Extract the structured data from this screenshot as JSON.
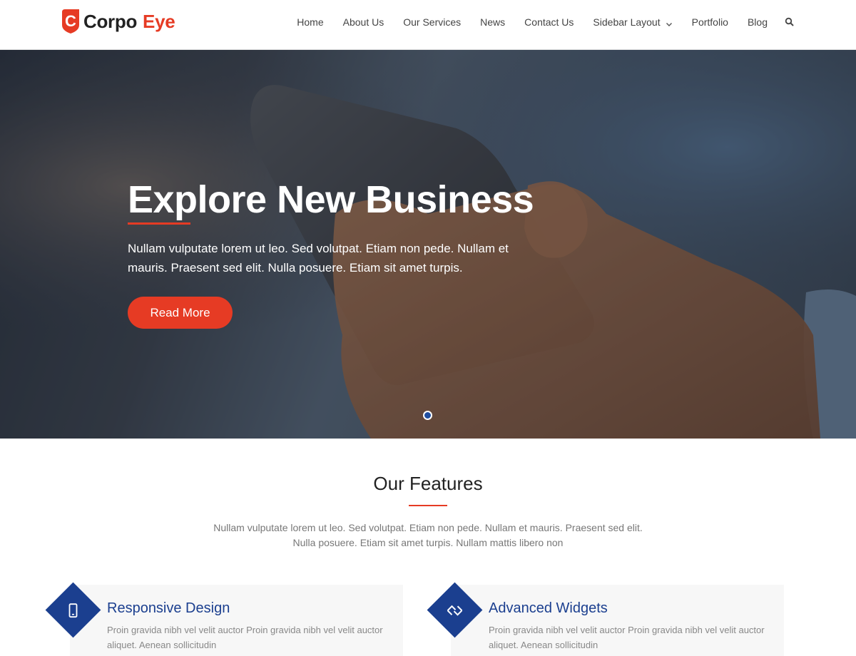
{
  "brand": {
    "name_part1": "Corpo",
    "name_part2": "Eye",
    "logo_letter": "C",
    "accent": "#e63b24",
    "primary": "#1b3f8f"
  },
  "nav": {
    "items": [
      "Home",
      "About Us",
      "Our Services",
      "News",
      "Contact Us",
      "Sidebar Layout",
      "Portfolio",
      "Blog"
    ],
    "dropdown_item": "Sidebar Layout",
    "search_icon": "search-icon"
  },
  "hero": {
    "title": "Explore New Business",
    "text": "Nullam vulputate lorem ut leo. Sed volutpat. Etiam non pede. Nullam et mauris. Praesent sed elit. Nulla posuere. Etiam sit amet turpis.",
    "button": "Read More",
    "slider_dots": 1,
    "active_dot": 1
  },
  "features": {
    "title": "Our Features",
    "intro": "Nullam vulputate lorem ut leo. Sed volutpat. Etiam non pede. Nullam et mauris. Praesent sed elit. Nulla posuere. Etiam sit amet turpis. Nullam mattis libero non",
    "items": [
      {
        "title": "Responsive Design",
        "icon": "mobile-phone-icon",
        "text": "Proin gravida nibh vel velit auctor Proin gravida nibh vel velit auctor aliquet. Aenean sollicitudin"
      },
      {
        "title": "Advanced Widgets",
        "icon": "widgets-icon",
        "text": "Proin gravida nibh vel velit auctor Proin gravida nibh vel velit auctor aliquet. Aenean sollicitudin"
      }
    ]
  }
}
